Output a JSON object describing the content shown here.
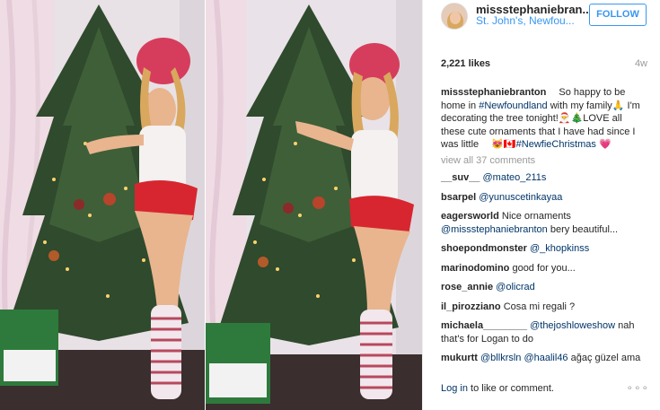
{
  "header": {
    "username": "missstephaniebran...",
    "location": "St. John's, Newfou...",
    "follow_label": "FOLLOW"
  },
  "stats": {
    "likes": "2,221 likes",
    "time": "4w"
  },
  "caption": {
    "username": "missstephaniebranton",
    "part1": "  So happy to be home in ",
    "hashtag1": "#Newfoundland",
    "part2": " with my family🙏 I'm decorating the tree tonight!🎅🎄LOVE all these cute ornaments that I have had since I was little  😻🇨🇦",
    "hashtag2": "#NewfieChristmas",
    "part3": " 💗"
  },
  "view_all": "view all 37 comments",
  "comments": [
    {
      "user": "__suv__",
      "mention": "@mateo_211s",
      "text": ""
    },
    {
      "user": "bsarpel",
      "mention": "@yunuscetinkayaa",
      "text": ""
    },
    {
      "user": "eagersworld",
      "mention": "",
      "text": "Nice ornaments",
      "mention2": "@missstephaniebranton",
      "text2": " bery beautiful..."
    },
    {
      "user": "shoepondmonster",
      "mention": "@_khopkinss",
      "text": ""
    },
    {
      "user": "marinodomino",
      "mention": "",
      "text": "good for you..."
    },
    {
      "user": "rose_annie",
      "mention": "@olicrad",
      "text": ""
    },
    {
      "user": "il_pirozziano",
      "mention": "",
      "text": "Cosa mi regali ?"
    },
    {
      "user": "michaela________",
      "mention": "@thejoshloweshow",
      "text": " nah that's for Logan to do"
    },
    {
      "user": "mukurtt",
      "mention": "@bllkrsln @haalil46",
      "text": " ağaç güzel ama"
    }
  ],
  "footer": {
    "login_link": "Log in",
    "login_text": " to like or comment.",
    "more": "∘∘∘"
  },
  "colors": {
    "link": "#003569",
    "accent": "#3897f0",
    "muted": "#999999"
  }
}
